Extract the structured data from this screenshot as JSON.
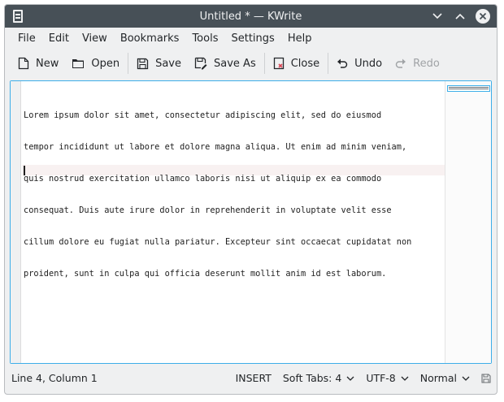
{
  "window": {
    "title": "Untitled * — KWrite"
  },
  "menu": [
    "File",
    "Edit",
    "View",
    "Bookmarks",
    "Tools",
    "Settings",
    "Help"
  ],
  "toolbar": {
    "new": "New",
    "open": "Open",
    "save": "Save",
    "save_as": "Save As",
    "close": "Close",
    "undo": "Undo",
    "redo": "Redo"
  },
  "editor": {
    "lines": [
      "Lorem ipsum dolor sit amet, consectetur adipiscing elit, sed do eiusmod",
      "tempor incididunt ut labore et dolore magna aliqua. Ut enim ad minim veniam,",
      "quis nostrud exercitation ullamco laboris nisi ut aliquip ex ea commodo",
      "consequat. Duis aute irure dolor in reprehenderit in voluptate velit esse",
      "cillum dolore eu fugiat nulla pariatur. Excepteur sint occaecat cupidatat non",
      "proident, sunt in culpa qui officia deserunt mollit anim id est laborum.",
      "",
      ""
    ]
  },
  "status": {
    "position": "Line 4, Column 1",
    "mode": "INSERT",
    "indent": "Soft Tabs: 4",
    "encoding": "UTF-8",
    "highlight": "Normal"
  },
  "icons": {
    "app": "kwrite-icon",
    "minimize": "chevron-down-icon",
    "maximize": "chevron-up-icon",
    "close": "close-icon",
    "new": "new-document-icon",
    "open": "folder-open-icon",
    "save": "save-icon",
    "save_as": "save-as-icon",
    "close_doc": "close-document-icon",
    "undo": "undo-icon",
    "redo": "redo-icon",
    "save_status": "save-status-icon"
  },
  "colors": {
    "titlebar": "#475057",
    "accent": "#3daee9",
    "close_red": "#da4453",
    "window_bg": "#eff0f1"
  }
}
